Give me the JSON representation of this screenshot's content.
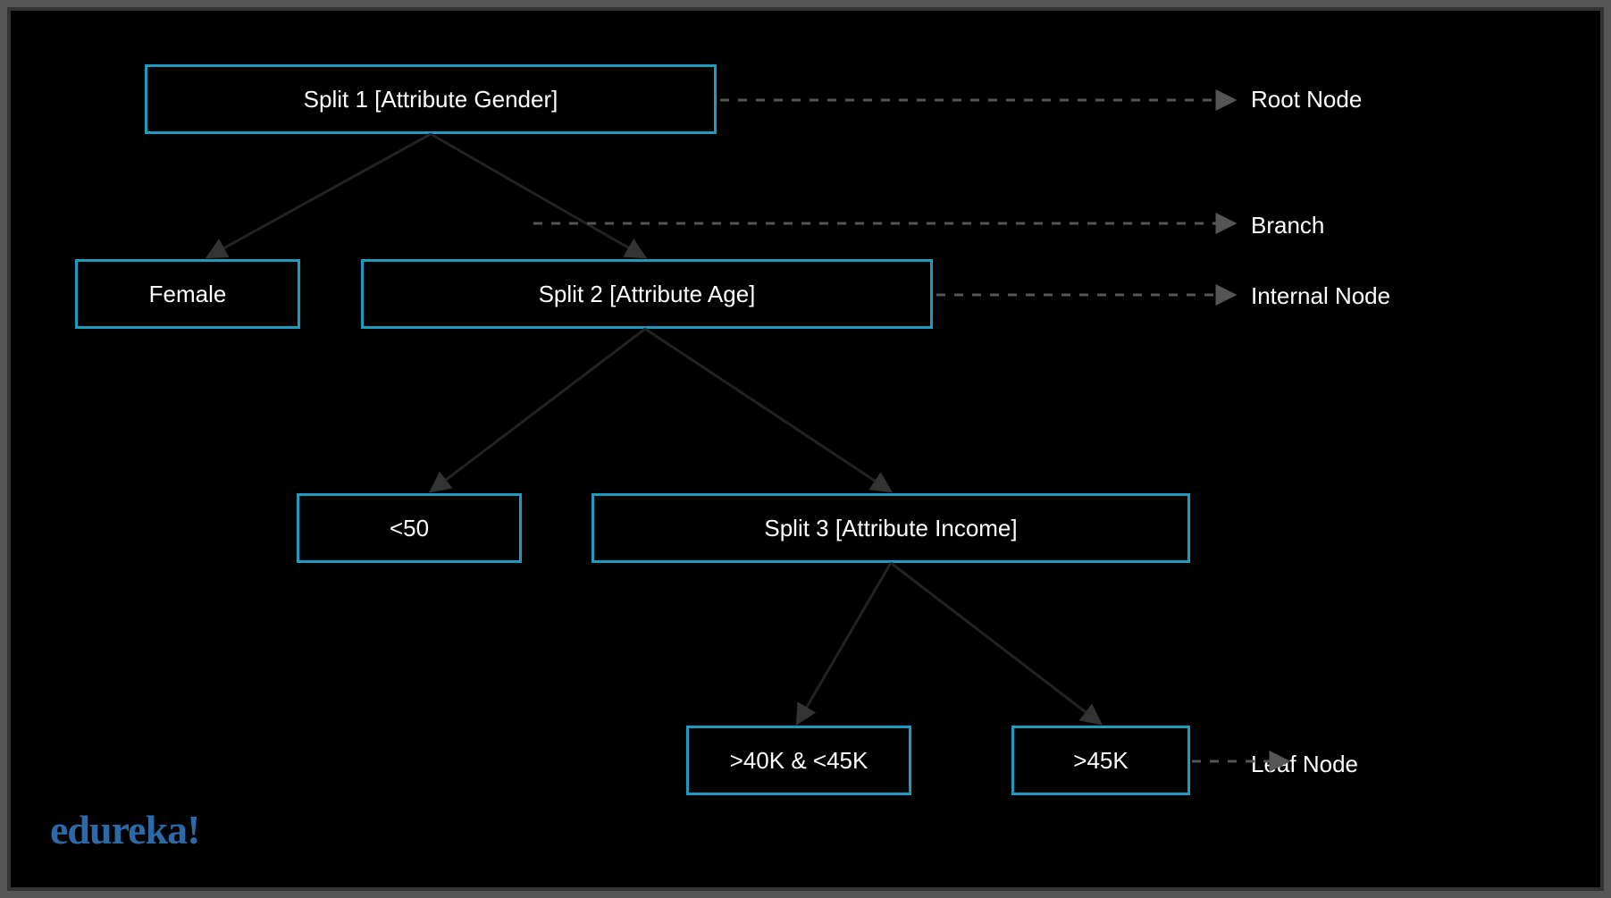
{
  "boxes": {
    "split1": "Split 1 [Attribute Gender]",
    "female": "Female",
    "split2": "Split 2 [Attribute Age]",
    "lt50": "<50",
    "split3": "Split 3 [Attribute Income]",
    "inc40_45": ">40K & <45K",
    "gt45k": ">45K"
  },
  "annotations": {
    "root": "Root Node",
    "branch": "Branch",
    "internal": "Internal Node",
    "leaf": "Leaf Node"
  },
  "logo": "edureka!"
}
